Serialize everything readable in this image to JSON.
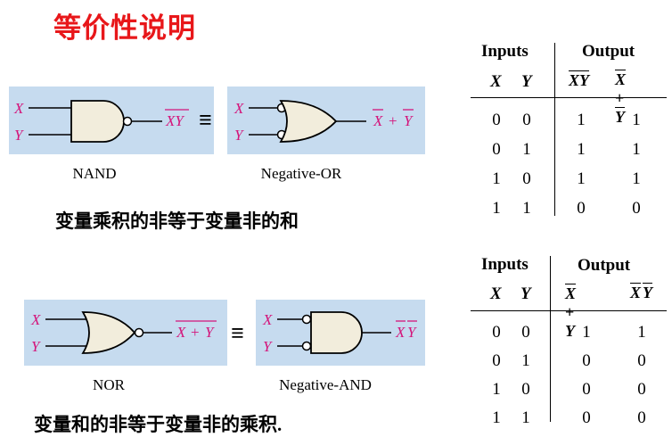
{
  "title": "等价性说明",
  "nand_section": {
    "left_gate_caption": "NAND",
    "right_gate_caption": "Negative-OR",
    "left_output": "XY",
    "right_output_a": "X",
    "right_output_plus": "+",
    "right_output_b": "Y",
    "statement": "变量乘积的非等于变量非的和"
  },
  "nor_section": {
    "left_gate_caption": "NOR",
    "right_gate_caption": "Negative-AND",
    "left_output_a": "X",
    "left_output_plus": "+",
    "left_output_b": "Y",
    "right_output_a": "X",
    "right_output_b": "Y",
    "statement": "变量和的非等于变量非的乘积."
  },
  "inputs": {
    "x": "X",
    "y": "Y"
  },
  "equiv_symbol": "≡",
  "table1": {
    "inputs_label": "Inputs",
    "output_label": "Output",
    "col_x": "X",
    "col_y": "Y",
    "expr1": "XY",
    "expr2_a": "X",
    "expr2_plus": "+",
    "expr2_b": "Y",
    "rows": [
      [
        "0",
        "0",
        "1",
        "1"
      ],
      [
        "0",
        "1",
        "1",
        "1"
      ],
      [
        "1",
        "0",
        "1",
        "1"
      ],
      [
        "1",
        "1",
        "0",
        "0"
      ]
    ]
  },
  "table2": {
    "inputs_label": "Inputs",
    "output_label": "Output",
    "col_x": "X",
    "col_y": "Y",
    "expr1_a": "X",
    "expr1_plus": "+",
    "expr1_b": "Y",
    "expr2_a": "X",
    "expr2_b": "Y",
    "rows": [
      [
        "0",
        "0",
        "1",
        "1"
      ],
      [
        "0",
        "1",
        "0",
        "0"
      ],
      [
        "1",
        "0",
        "0",
        "0"
      ],
      [
        "1",
        "1",
        "0",
        "0"
      ]
    ]
  },
  "colors": {
    "title": "#e8171a",
    "panel": "#c6dbef",
    "variable": "#d4147a",
    "gate_fill": "#f2eddc"
  }
}
